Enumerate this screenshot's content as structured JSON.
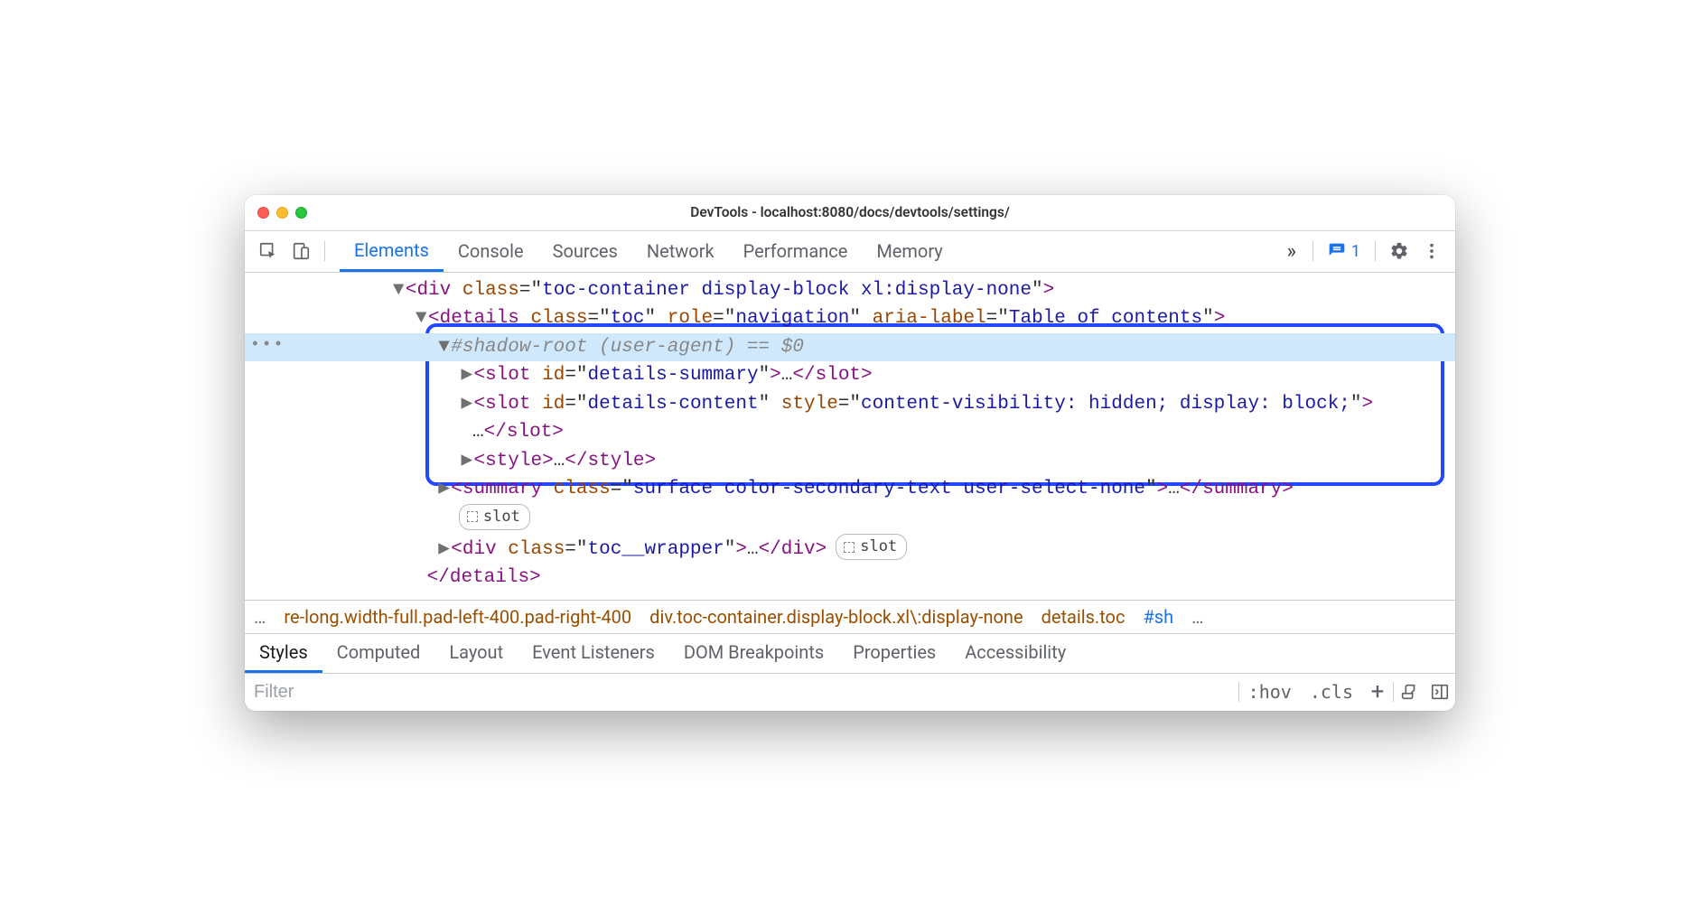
{
  "window": {
    "title": "DevTools - localhost:8080/docs/devtools/settings/"
  },
  "toolbar": {
    "tabs": [
      "Elements",
      "Console",
      "Sources",
      "Network",
      "Performance",
      "Memory"
    ],
    "active_tab_index": 0,
    "issues_count": "1"
  },
  "dom": {
    "line1": {
      "tag": "div",
      "attr": "class",
      "val": "toc-container display-block xl:display-none"
    },
    "line2": {
      "tag": "details",
      "a1n": "class",
      "a1v": "toc",
      "a2n": "role",
      "a2v": "navigation",
      "a3n": "aria-label",
      "a3v": "Table of contents"
    },
    "line3": {
      "text": "#shadow-root (user-agent)",
      "eq": " == ",
      "var": "$0"
    },
    "line4": {
      "tag": "slot",
      "attr": "id",
      "val": "details-summary",
      "ell": "…"
    },
    "line5": {
      "tag": "slot",
      "a1n": "id",
      "a1v": "details-content",
      "a2n": "style",
      "a2v": "content-visibility: hidden; display: block;",
      "ell": "…"
    },
    "line6": {
      "tag": "style",
      "ell": "…"
    },
    "line7": {
      "tag": "summary",
      "attr": "class",
      "val": "surface color-secondary-text user-select-none",
      "ell": "…"
    },
    "line8": {
      "tag": "div",
      "attr": "class",
      "val": "toc__wrapper",
      "ell": "…"
    },
    "line9": {
      "tag": "details"
    },
    "slotchip": "slot"
  },
  "breadcrumb": {
    "ell1": "…",
    "b1": "re-long.width-full.pad-left-400.pad-right-400",
    "b2": "div.toc-container.display-block.xl\\:display-none",
    "b3": "details.toc",
    "b4": "#sh",
    "ell2": "…"
  },
  "subtabs": {
    "items": [
      "Styles",
      "Computed",
      "Layout",
      "Event Listeners",
      "DOM Breakpoints",
      "Properties",
      "Accessibility"
    ],
    "active_index": 0
  },
  "filter": {
    "placeholder": "Filter",
    "hov": ":hov",
    "cls": ".cls"
  }
}
